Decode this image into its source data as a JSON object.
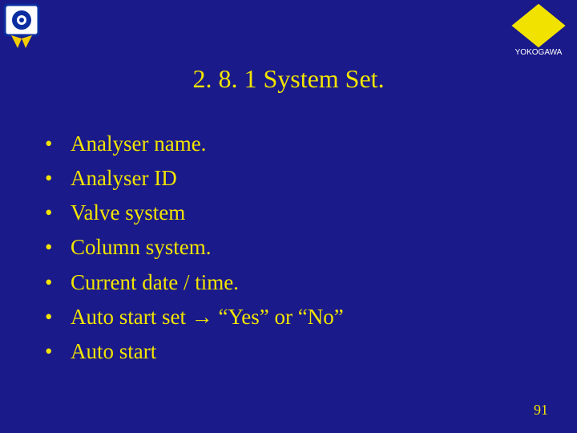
{
  "title": "2. 8. 1 System Set.",
  "bullets": [
    "Analyser name.",
    "Analyser ID",
    "Valve system",
    "Column system.",
    "Current date / time.",
    "Auto start set → “Yes” or “No”",
    "Auto start"
  ],
  "pageNumber": "91",
  "logo": {
    "brand": "YOKOGAWA"
  }
}
